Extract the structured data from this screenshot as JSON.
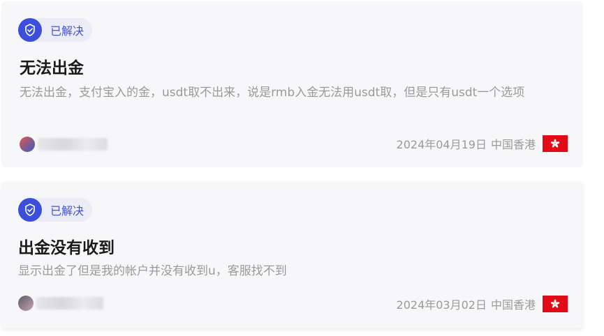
{
  "posts": [
    {
      "status": "已解决",
      "title": "无法出金",
      "description": "无法出金，支付宝入的金，usdt取不出来，说是rmb入金无法用usdt取，但是只有usdt一个选项",
      "date": "2024年04月19日",
      "region": "中国香港",
      "flag_icon": "hong-kong-flag-icon"
    },
    {
      "status": "已解决",
      "title": "出金没有收到",
      "description": "显示出金了但是我的帐户并没有收到u，客服找不到",
      "date": "2024年03月02日",
      "region": "中国香港",
      "flag_icon": "hong-kong-flag-icon"
    }
  ],
  "colors": {
    "status_icon_bg": "#3b4fd8",
    "status_text": "#4656c8",
    "flag_red": "#e30a17"
  }
}
